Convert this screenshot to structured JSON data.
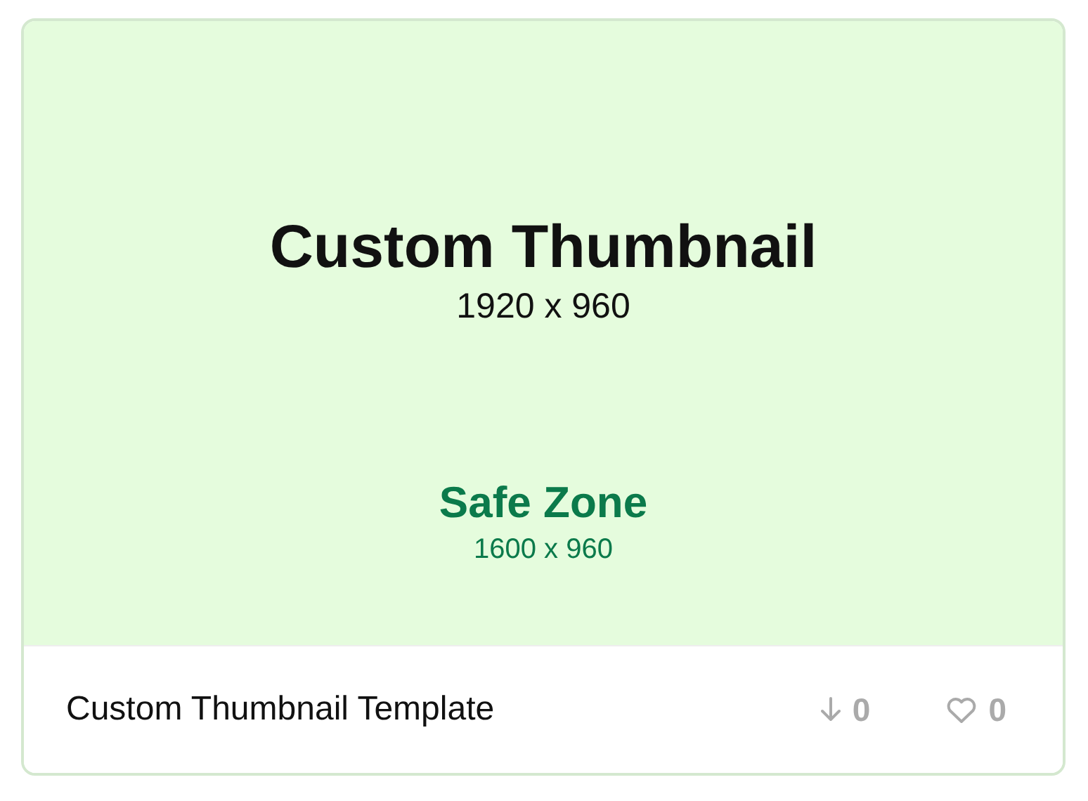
{
  "thumbnail": {
    "title": "Custom Thumbnail",
    "size": "1920 x 960",
    "safe_zone": {
      "title": "Safe Zone",
      "size": "1600 x 960"
    }
  },
  "footer": {
    "name": "Custom Thumbnail Template",
    "downloads": "0",
    "likes": "0"
  }
}
